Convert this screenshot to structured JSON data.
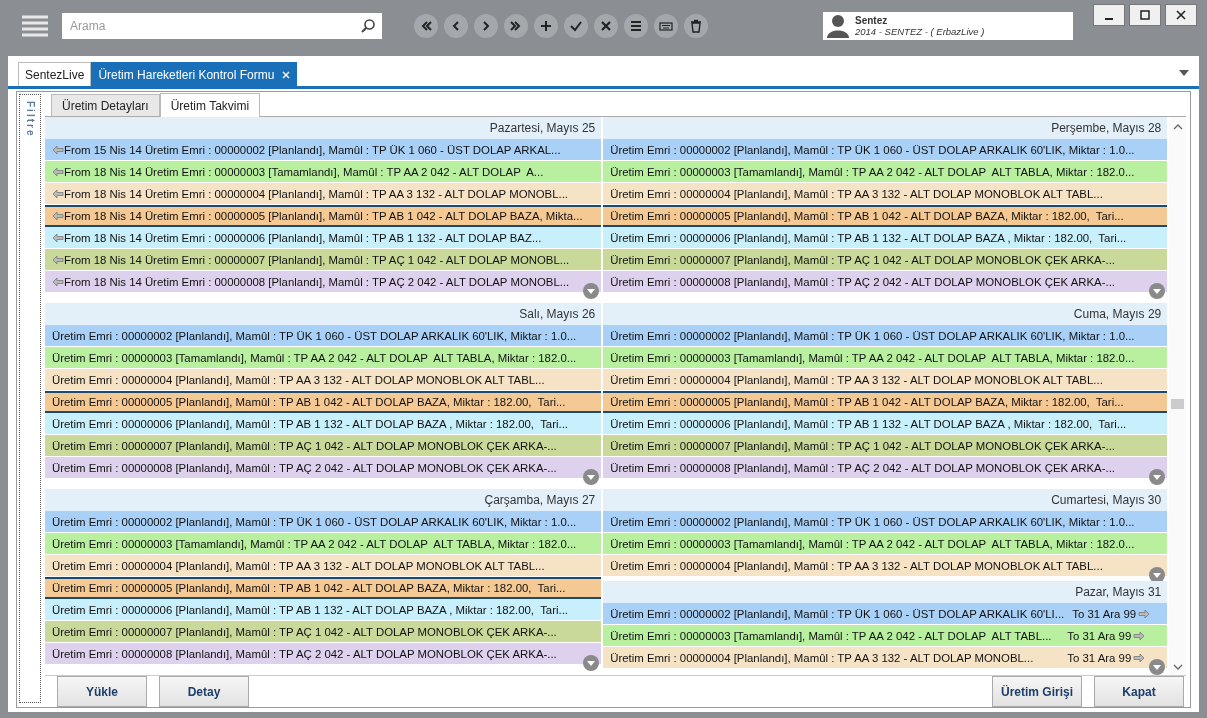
{
  "search": {
    "placeholder": "Arama"
  },
  "toolbar": [
    {
      "kind": "first"
    },
    {
      "kind": "prev"
    },
    {
      "kind": "next"
    },
    {
      "kind": "last"
    },
    {
      "kind": "add"
    },
    {
      "kind": "confirm"
    },
    {
      "kind": "cancel"
    },
    {
      "kind": "list"
    },
    {
      "kind": "keyboard"
    },
    {
      "kind": "delete"
    }
  ],
  "user": {
    "name": "Sentez",
    "detail": "2014 - SENTEZ - ( ErbazLive )"
  },
  "tabs": [
    {
      "label": "SentezLive",
      "selected": false,
      "closable": false
    },
    {
      "label": "Üretim Hareketleri Kontrol Formu",
      "selected": true,
      "closable": true
    }
  ],
  "sidebar": {
    "label": "Filtre"
  },
  "subtabs": [
    {
      "label": "Üretim Detayları",
      "selected": false
    },
    {
      "label": "Üretim Takvimi",
      "selected": true
    }
  ],
  "calendar": {
    "columns": [
      {
        "days": [
          {
            "title": "Pazartesi, Mayıs 25",
            "more": true,
            "events": [
              {
                "from": "From 15 Nis 14",
                "text": "Üretim Emri : 00000002 [Planlandı], Mamûl : TP ÜK 1 060 - ÜST DOLAP ARKAL...",
                "color": "#a9d1f7",
                "selected": false
              },
              {
                "from": "From 18 Nis 14",
                "text": "Üretim Emri : 00000003 [Tamamlandı], Mamûl : TP AA 2 042 - ALT DOLAP  A...",
                "color": "#b8f0a0",
                "selected": false
              },
              {
                "from": "From 18 Nis 14",
                "text": "Üretim Emri : 00000004 [Planlandı], Mamûl : TP AA 3 132 - ALT DOLAP MONOBL...",
                "color": "#f6e3c6",
                "selected": false
              },
              {
                "from": "From 18 Nis 14",
                "text": "Üretim Emri : 00000005 [Planlandı], Mamûl : TP AB 1 042 - ALT DOLAP BAZA, Mikta...",
                "color": "#f5c994",
                "selected": true
              },
              {
                "from": "From 18 Nis 14",
                "text": "Üretim Emri : 00000006 [Planlandı], Mamûl : TP AB 1 132 - ALT DOLAP BAZ...",
                "color": "#c8effc",
                "selected": false
              },
              {
                "from": "From 18 Nis 14",
                "text": "Üretim Emri : 00000007 [Planlandı], Mamûl : TP AÇ 1 042 - ALT DOLAP MONOBL...",
                "color": "#c9d99a",
                "selected": false
              },
              {
                "from": "From 18 Nis 14",
                "text": "Üretim Emri : 00000008 [Planlandı], Mamûl : TP AÇ 2 042 - ALT DOLAP MONOBL...",
                "color": "#ded1ed",
                "selected": false
              }
            ]
          },
          {
            "title": "Salı, Mayıs 26",
            "more": true,
            "events": [
              {
                "text": "Üretim Emri : 00000002 [Planlandı], Mamûl : TP ÜK 1 060 - ÜST DOLAP ARKALIK 60'LIK, Miktar : 1.0...",
                "color": "#a9d1f7",
                "selected": false
              },
              {
                "text": "Üretim Emri : 00000003 [Tamamlandı], Mamûl : TP AA 2 042 - ALT DOLAP  ALT TABLA, Miktar : 182.0...",
                "color": "#b8f0a0",
                "selected": false
              },
              {
                "text": "Üretim Emri : 00000004 [Planlandı], Mamûl : TP AA 3 132 - ALT DOLAP MONOBLOK ALT TABL...",
                "color": "#f6e3c6",
                "selected": false
              },
              {
                "text": "Üretim Emri : 00000005 [Planlandı], Mamûl : TP AB 1 042 - ALT DOLAP BAZA, Miktar : 182.00,  Tari...",
                "color": "#f5c994",
                "selected": true
              },
              {
                "text": "Üretim Emri : 00000006 [Planlandı], Mamûl : TP AB 1 132 - ALT DOLAP BAZA , Miktar : 182.00,  Tari...",
                "color": "#c8effc",
                "selected": false
              },
              {
                "text": "Üretim Emri : 00000007 [Planlandı], Mamûl : TP AÇ 1 042 - ALT DOLAP MONOBLOK ÇEK ARKA-...",
                "color": "#c9d99a",
                "selected": false
              },
              {
                "text": "Üretim Emri : 00000008 [Planlandı], Mamûl : TP AÇ 2 042 - ALT DOLAP MONOBLOK ÇEK ARKA-...",
                "color": "#ded1ed",
                "selected": false
              }
            ]
          },
          {
            "title": "Çarşamba, Mayıs 27",
            "more": true,
            "events": [
              {
                "text": "Üretim Emri : 00000002 [Planlandı], Mamûl : TP ÜK 1 060 - ÜST DOLAP ARKALIK 60'LIK, Miktar : 1.0...",
                "color": "#a9d1f7",
                "selected": false
              },
              {
                "text": "Üretim Emri : 00000003 [Tamamlandı], Mamûl : TP AA 2 042 - ALT DOLAP  ALT TABLA, Miktar : 182.0...",
                "color": "#b8f0a0",
                "selected": false
              },
              {
                "text": "Üretim Emri : 00000004 [Planlandı], Mamûl : TP AA 3 132 - ALT DOLAP MONOBLOK ALT TABL...",
                "color": "#f6e3c6",
                "selected": false
              },
              {
                "text": "Üretim Emri : 00000005 [Planlandı], Mamûl : TP AB 1 042 - ALT DOLAP BAZA, Miktar : 182.00,  Tari...",
                "color": "#f5c994",
                "selected": true
              },
              {
                "text": "Üretim Emri : 00000006 [Planlandı], Mamûl : TP AB 1 132 - ALT DOLAP BAZA , Miktar : 182.00,  Tari...",
                "color": "#c8effc",
                "selected": false
              },
              {
                "text": "Üretim Emri : 00000007 [Planlandı], Mamûl : TP AÇ 1 042 - ALT DOLAP MONOBLOK ÇEK ARKA-...",
                "color": "#c9d99a",
                "selected": false
              },
              {
                "text": "Üretim Emri : 00000008 [Planlandı], Mamûl : TP AÇ 2 042 - ALT DOLAP MONOBLOK ÇEK ARKA-...",
                "color": "#ded1ed",
                "selected": false
              }
            ]
          }
        ]
      },
      {
        "days": [
          {
            "title": "Perşembe, Mayıs 28",
            "more": true,
            "events": [
              {
                "text": "Üretim Emri : 00000002 [Planlandı], Mamûl : TP ÜK 1 060 - ÜST DOLAP ARKALIK 60'LIK, Miktar : 1.0...",
                "color": "#a9d1f7",
                "selected": false
              },
              {
                "text": "Üretim Emri : 00000003 [Tamamlandı], Mamûl : TP AA 2 042 - ALT DOLAP  ALT TABLA, Miktar : 182.0...",
                "color": "#b8f0a0",
                "selected": false
              },
              {
                "text": "Üretim Emri : 00000004 [Planlandı], Mamûl : TP AA 3 132 - ALT DOLAP MONOBLOK ALT TABL...",
                "color": "#f6e3c6",
                "selected": false
              },
              {
                "text": "Üretim Emri : 00000005 [Planlandı], Mamûl : TP AB 1 042 - ALT DOLAP BAZA, Miktar : 182.00,  Tari...",
                "color": "#f5c994",
                "selected": true
              },
              {
                "text": "Üretim Emri : 00000006 [Planlandı], Mamûl : TP AB 1 132 - ALT DOLAP BAZA , Miktar : 182.00,  Tari...",
                "color": "#c8effc",
                "selected": false
              },
              {
                "text": "Üretim Emri : 00000007 [Planlandı], Mamûl : TP AÇ 1 042 - ALT DOLAP MONOBLOK ÇEK ARKA-...",
                "color": "#c9d99a",
                "selected": false
              },
              {
                "text": "Üretim Emri : 00000008 [Planlandı], Mamûl : TP AÇ 2 042 - ALT DOLAP MONOBLOK ÇEK ARKA-...",
                "color": "#ded1ed",
                "selected": false
              }
            ]
          },
          {
            "title": "Cuma, Mayıs 29",
            "more": true,
            "events": [
              {
                "text": "Üretim Emri : 00000002 [Planlandı], Mamûl : TP ÜK 1 060 - ÜST DOLAP ARKALIK 60'LIK, Miktar : 1.0...",
                "color": "#a9d1f7",
                "selected": false
              },
              {
                "text": "Üretim Emri : 00000003 [Tamamlandı], Mamûl : TP AA 2 042 - ALT DOLAP  ALT TABLA, Miktar : 182.0...",
                "color": "#b8f0a0",
                "selected": false
              },
              {
                "text": "Üretim Emri : 00000004 [Planlandı], Mamûl : TP AA 3 132 - ALT DOLAP MONOBLOK ALT TABL...",
                "color": "#f6e3c6",
                "selected": false
              },
              {
                "text": "Üretim Emri : 00000005 [Planlandı], Mamûl : TP AB 1 042 - ALT DOLAP BAZA, Miktar : 182.00,  Tari...",
                "color": "#f5c994",
                "selected": true
              },
              {
                "text": "Üretim Emri : 00000006 [Planlandı], Mamûl : TP AB 1 132 - ALT DOLAP BAZA , Miktar : 182.00,  Tari...",
                "color": "#c8effc",
                "selected": false
              },
              {
                "text": "Üretim Emri : 00000007 [Planlandı], Mamûl : TP AÇ 1 042 - ALT DOLAP MONOBLOK ÇEK ARKA-...",
                "color": "#c9d99a",
                "selected": false
              },
              {
                "text": "Üretim Emri : 00000008 [Planlandı], Mamûl : TP AÇ 2 042 - ALT DOLAP MONOBLOK ÇEK ARKA-...",
                "color": "#ded1ed",
                "selected": false
              }
            ]
          },
          {
            "title": "Cumartesi, Mayıs 30",
            "more": true,
            "events": [
              {
                "text": "Üretim Emri : 00000002 [Planlandı], Mamûl : TP ÜK 1 060 - ÜST DOLAP ARKALIK 60'LIK, Miktar : 1.0...",
                "color": "#a9d1f7",
                "selected": false
              },
              {
                "text": "Üretim Emri : 00000003 [Tamamlandı], Mamûl : TP AA 2 042 - ALT DOLAP  ALT TABLA, Miktar : 182.0...",
                "color": "#b8f0a0",
                "selected": false
              },
              {
                "text": "Üretim Emri : 00000004 [Planlandı], Mamûl : TP AA 3 132 - ALT DOLAP MONOBLOK ALT TABL...",
                "color": "#f6e3c6",
                "selected": false
              }
            ]
          },
          {
            "title": "Pazar, Mayıs 31",
            "more": true,
            "events": [
              {
                "text": "Üretim Emri : 00000002 [Planlandı], Mamûl : TP ÜK 1 060 - ÜST DOLAP ARKALIK 60'LI...",
                "to": "To 31 Ara 99",
                "color": "#a9d1f7",
                "selected": false
              },
              {
                "text": "Üretim Emri : 00000003 [Tamamlandı], Mamûl : TP AA 2 042 - ALT DOLAP  ALT TABL...",
                "to": "To 31 Ara 99",
                "color": "#b8f0a0",
                "selected": false
              },
              {
                "text": "Üretim Emri : 00000004 [Planlandı], Mamûl : TP AA 3 132 - ALT DOLAP MONOBL...",
                "to": "To 31 Ara 99",
                "color": "#f6e3c6",
                "selected": false
              }
            ]
          }
        ]
      }
    ]
  },
  "buttons_left": [
    "Yükle",
    "Detay"
  ],
  "buttons_right": [
    "Üretim Girişi",
    "Kapat"
  ]
}
